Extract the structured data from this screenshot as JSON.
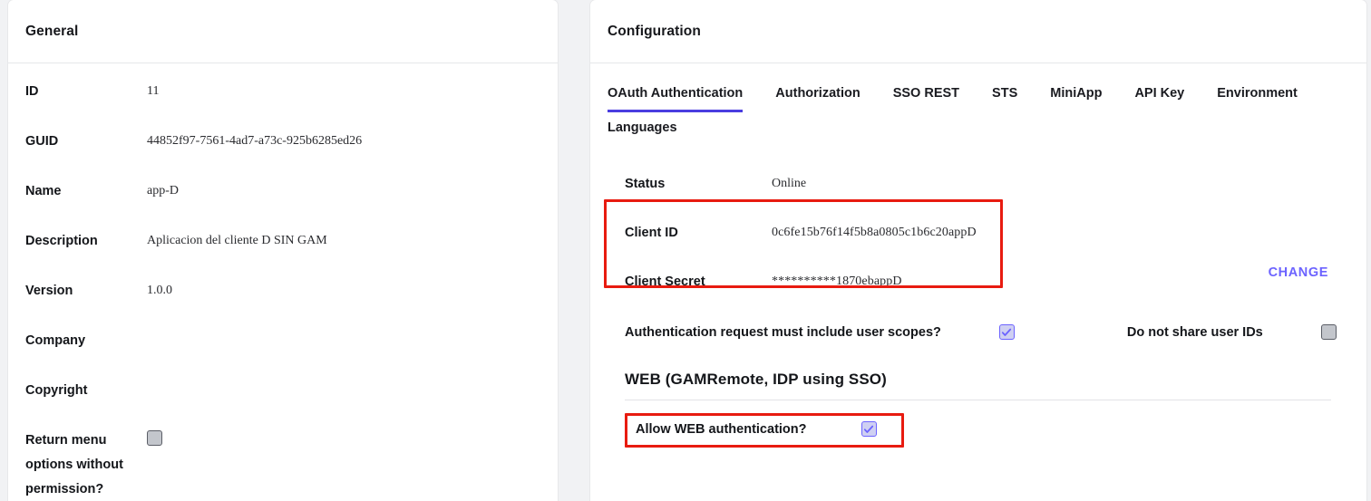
{
  "left_panel": {
    "title": "General",
    "fields": [
      {
        "label": "ID",
        "value": "11"
      },
      {
        "label": "GUID",
        "value": "44852f97-7561-4ad7-a73c-925b6285ed26"
      },
      {
        "label": "Name",
        "value": "app-D"
      },
      {
        "label": "Description",
        "value": "Aplicacion del cliente D SIN GAM"
      },
      {
        "label": "Version",
        "value": "1.0.0"
      },
      {
        "label": "Company",
        "value": ""
      },
      {
        "label": "Copyright",
        "value": ""
      }
    ],
    "return_menu": {
      "label": "Return menu options without permission?",
      "checked": false,
      "icon": "checkbox-unchecked-icon"
    }
  },
  "right_panel": {
    "title": "Configuration",
    "tabs": [
      {
        "label": "OAuth Authentication",
        "active": true
      },
      {
        "label": "Authorization",
        "active": false
      },
      {
        "label": "SSO REST",
        "active": false
      },
      {
        "label": "STS",
        "active": false
      },
      {
        "label": "MiniApp",
        "active": false
      },
      {
        "label": "API Key",
        "active": false
      },
      {
        "label": "Environment",
        "active": false
      },
      {
        "label": "Languages",
        "active": false
      }
    ],
    "status": {
      "label": "Status",
      "value": "Online"
    },
    "client_id": {
      "label": "Client ID",
      "value": "0c6fe15b76f14f5b8a0805c1b6c20appD"
    },
    "client_secret": {
      "label": "Client Secret",
      "value": "**********1870ebappD"
    },
    "change_label": "CHANGE",
    "checkboxes": {
      "user_scopes": {
        "label": "Authentication request must include user scopes?",
        "checked": true,
        "icon": "checkbox-checked-icon"
      },
      "do_not_share_user_ids": {
        "label": "Do not share user IDs",
        "checked": false,
        "icon": "checkbox-unchecked-icon"
      },
      "allow_web_auth": {
        "label": "Allow WEB authentication?",
        "checked": true,
        "icon": "checkbox-checked-icon"
      }
    },
    "web_section": {
      "title": "WEB (GAMRemote, IDP using SSO)"
    }
  },
  "colors": {
    "accent": "#4a3ee0",
    "link": "#6c63ff",
    "highlight": "#e81b10",
    "background": "#f1f2f4",
    "card": "#ffffff"
  }
}
